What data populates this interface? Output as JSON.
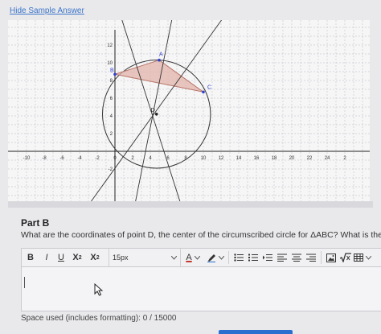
{
  "links": {
    "hide_sample": "Hide Sample Answer"
  },
  "graph": {
    "x_ticks": [
      "-10",
      "-8",
      "-6",
      "-4",
      "-2",
      "0",
      "2",
      "4",
      "6",
      "8",
      "10",
      "12",
      "14",
      "16",
      "18",
      "20",
      "22",
      "24",
      "2"
    ],
    "y_ticks": [
      "12",
      "10",
      "8",
      "6",
      "4",
      "2",
      "-2"
    ],
    "points": {
      "A": "A",
      "B": "B",
      "C": "C",
      "D": "D"
    },
    "colors": {
      "triangle_fill": "#e2b3aa",
      "triangle_stroke": "#b9776a",
      "point": "#2f3fcf",
      "line": "#333333"
    }
  },
  "part": {
    "title": "Part B",
    "question": "What are the coordinates of point D, the center of the circumscribed circle for ΔABC? What is the radius of the ci"
  },
  "toolbar": {
    "bold": "B",
    "italic": "I",
    "underline": "U",
    "superscript": "X",
    "subscript": "X",
    "sup_mark": "2",
    "sub_mark": "2",
    "font_size": "15px",
    "font_color": "A"
  },
  "footer": {
    "space_used": "Space used (includes formatting): 0 / 15000"
  }
}
